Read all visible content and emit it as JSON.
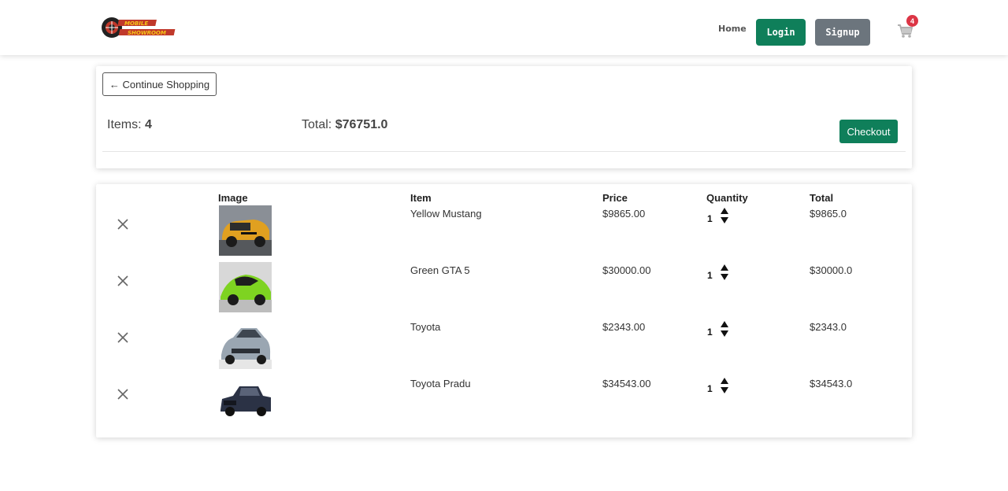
{
  "navbar": {
    "logo_text": "MOBILE SHOWROOM",
    "home_label": "Home",
    "login_label": "Login",
    "signup_label": "Signup",
    "cart_count": "4"
  },
  "summary": {
    "continue_label": "← Continue Shopping",
    "items_label": "Items:",
    "items_value": "4",
    "total_label": "Total:",
    "total_value": "$76751.0",
    "checkout_label": "Checkout"
  },
  "table": {
    "headers": {
      "image": "Image",
      "item": "Item",
      "price": "Price",
      "quantity": "Quantity",
      "total": "Total"
    },
    "rows": [
      {
        "item": "Yellow Mustang",
        "price": "$9865.00",
        "quantity": "1",
        "total": "$9865.0",
        "car_color": "#e0a020"
      },
      {
        "item": "Green GTA 5",
        "price": "$30000.00",
        "quantity": "1",
        "total": "$30000.0",
        "car_color": "#7ed321"
      },
      {
        "item": "Toyota",
        "price": "$2343.00",
        "quantity": "1",
        "total": "$2343.0",
        "car_color": "#9aa6b2"
      },
      {
        "item": "Toyota Pradu",
        "price": "$34543.00",
        "quantity": "1",
        "total": "$34543.0",
        "car_color": "#2b3245"
      }
    ]
  },
  "colors": {
    "primary_green": "#0f7f5a",
    "secondary_gray": "#6c757d",
    "badge_red": "#dc3545"
  }
}
